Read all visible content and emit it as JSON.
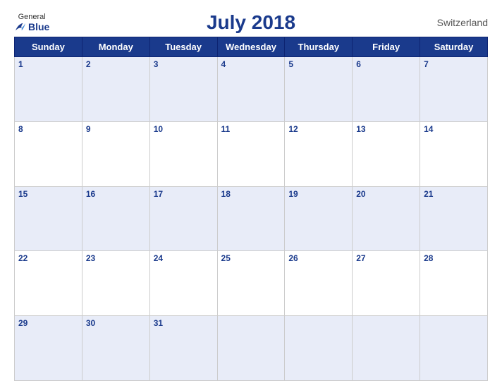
{
  "header": {
    "title": "July 2018",
    "country": "Switzerland",
    "logo": {
      "general": "General",
      "blue": "Blue"
    }
  },
  "days": [
    "Sunday",
    "Monday",
    "Tuesday",
    "Wednesday",
    "Thursday",
    "Friday",
    "Saturday"
  ],
  "weeks": [
    [
      1,
      2,
      3,
      4,
      5,
      6,
      7
    ],
    [
      8,
      9,
      10,
      11,
      12,
      13,
      14
    ],
    [
      15,
      16,
      17,
      18,
      19,
      20,
      21
    ],
    [
      22,
      23,
      24,
      25,
      26,
      27,
      28
    ],
    [
      29,
      30,
      31,
      null,
      null,
      null,
      null
    ]
  ]
}
